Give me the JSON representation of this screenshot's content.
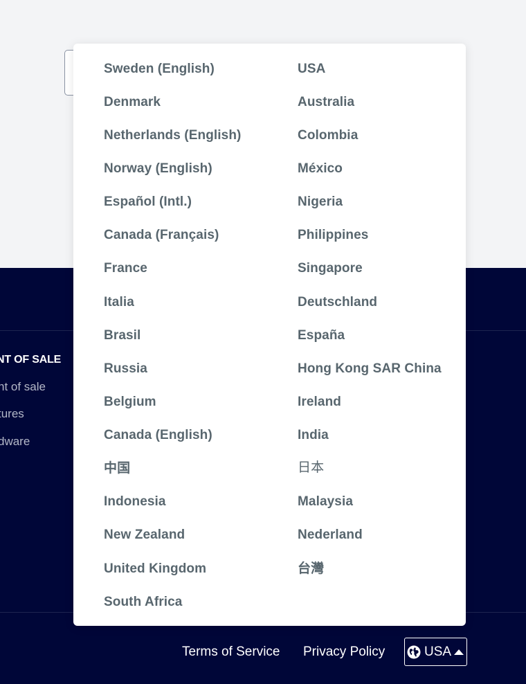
{
  "dropdown": {
    "left_column": [
      "Sweden (English)",
      "Denmark",
      "Netherlands (English)",
      "Norway (English)",
      "Español (Intl.)",
      "Canada (Français)",
      "France",
      "Italia",
      "Brasil",
      "Russia",
      "Belgium",
      "Canada (English)",
      "中国",
      "Indonesia",
      "New Zealand",
      "United Kingdom",
      "South Africa"
    ],
    "right_column": [
      "USA",
      "Australia",
      "Colombia",
      "México",
      "Nigeria",
      "Philippines",
      "Singapore",
      "Deutschland",
      "España",
      "Hong Kong SAR China",
      "Ireland",
      "India",
      "日本",
      "Malaysia",
      "Nederland",
      "台灣"
    ]
  },
  "footer": {
    "column_title": "NT OF SALE",
    "links": [
      "nt of sale",
      "tures",
      "dware"
    ],
    "terms_label": "Terms of Service",
    "privacy_label": "Privacy Policy",
    "country_label": "USA"
  },
  "colors": {
    "footer_bg": "#000638",
    "option_text": "#58666e",
    "page_bg": "#f3f4f6"
  }
}
